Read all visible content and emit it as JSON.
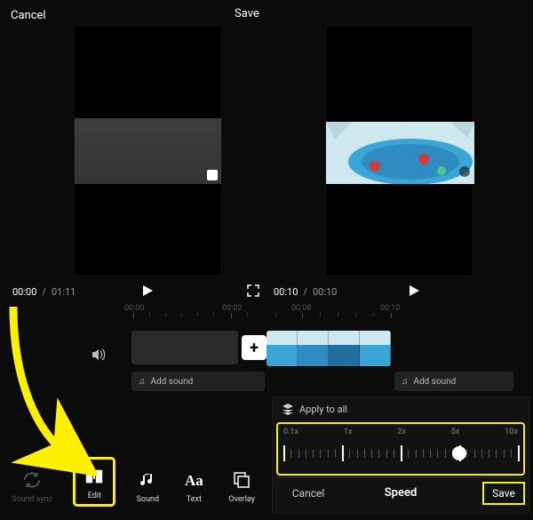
{
  "left": {
    "cancel": "Cancel",
    "save": "Save",
    "time_cur": "00:00",
    "time_total": "01:11",
    "ticks": [
      "00:00",
      "00:02"
    ],
    "add_sound": "Add sound"
  },
  "right": {
    "time_cur": "00:10",
    "time_total": "00:10",
    "ticks": [
      "00:08",
      "00:10"
    ],
    "add_sound": "Add sound"
  },
  "tools": {
    "sound_sync": "Sound sync",
    "edit": "Edit",
    "sound": "Sound",
    "text": "Text",
    "overlay": "Overlay"
  },
  "speed_panel": {
    "apply_all": "Apply to all",
    "labels": [
      "0.1x",
      "1x",
      "2x",
      "5x",
      "10x"
    ],
    "cancel": "Cancel",
    "title": "Speed",
    "save": "Save",
    "knob_position_pct": 75
  },
  "colors": {
    "highlight": "#fcf000",
    "pool1": "#3aa6d6",
    "pool2": "#2f8bc0",
    "pool3": "#1f6f9f",
    "ice": "#cfe7ee"
  }
}
